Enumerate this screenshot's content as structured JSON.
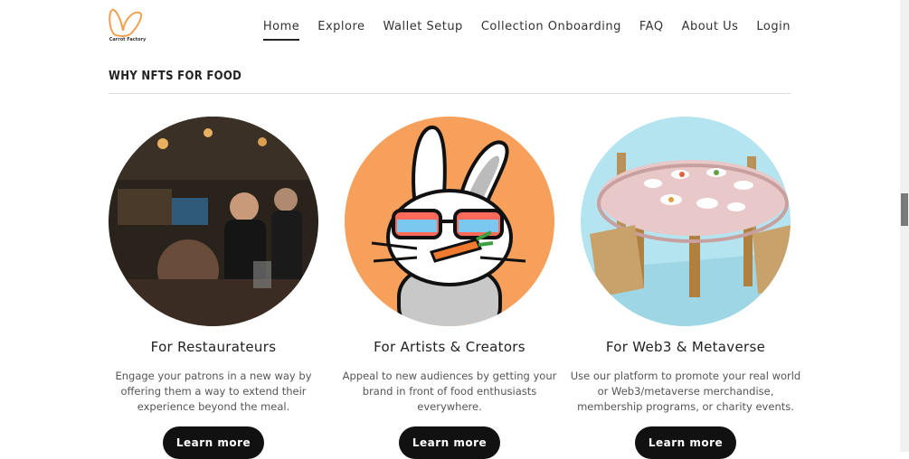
{
  "brand": {
    "name": "Carrot Factory"
  },
  "nav": [
    {
      "label": "Home",
      "active": true
    },
    {
      "label": "Explore"
    },
    {
      "label": "Wallet Setup"
    },
    {
      "label": "Collection Onboarding"
    },
    {
      "label": "FAQ"
    },
    {
      "label": "About Us"
    },
    {
      "label": "Login"
    }
  ],
  "section": {
    "title": "WHY NFTS FOR FOOD"
  },
  "cards": [
    {
      "title": "For Restaurateurs",
      "text": "Engage your patrons in a new way by offering them a way to extend their experience beyond the meal.",
      "button": "Learn more",
      "image": "restaurant-photo"
    },
    {
      "title": "For Artists & Creators",
      "text": "Appeal to new audiences by getting your brand in front of food enthusiasts everywhere.",
      "button": "Learn more",
      "image": "rabbit-illustration"
    },
    {
      "title": "For Web3 & Metaverse",
      "text": "Use our platform to promote your real world or Web3/metaverse merchandise, membership programs, or charity events.",
      "button": "Learn more",
      "image": "3d-dining-table"
    }
  ],
  "colors": {
    "accent": "#f7a05c",
    "button": "#111111",
    "sky": "#b4e4ef"
  }
}
